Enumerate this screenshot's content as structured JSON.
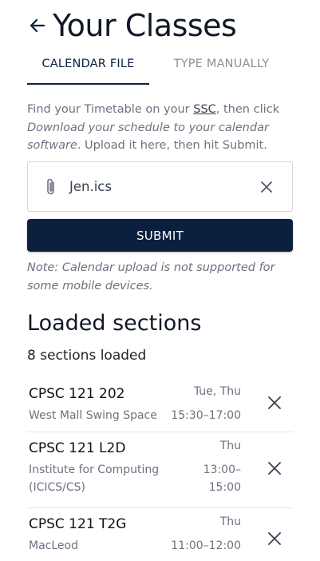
{
  "header": {
    "title": "Your Classes",
    "back_icon": "arrow-left-icon"
  },
  "tabs": [
    {
      "label": "CALENDAR FILE",
      "active": true
    },
    {
      "label": "TYPE MANUALLY",
      "active": false
    }
  ],
  "instructions": {
    "part1": "Find your Timetable on your ",
    "link": "SSC",
    "part2": ", then click ",
    "emphasis": "Download your schedule to your calendar software",
    "part3": ". Upload it here, then hit Submit."
  },
  "file_field": {
    "file_name": "Jen.ics",
    "attach_icon": "paperclip-icon",
    "clear_icon": "close-icon"
  },
  "submit_label": "SUBMIT",
  "note": "Note: Calendar upload is not supported for some mobile devices.",
  "loaded": {
    "heading": "Loaded sections",
    "count": "8 sections loaded",
    "sections": [
      {
        "code": "CPSC 121 202",
        "location": "West Mall Swing Space",
        "days": "Tue, Thu",
        "time": "15:30–17:00"
      },
      {
        "code": "CPSC 121 L2D",
        "location": "Institute for Computing (ICICS/CS)",
        "days": "Thu",
        "time": "13:00–15:00"
      },
      {
        "code": "CPSC 121 T2G",
        "location": "MacLeod",
        "days": "Thu",
        "time": "11:00–12:00"
      }
    ]
  },
  "colors": {
    "primary": "#0b1f3f",
    "muted_text": "#6b7280",
    "border": "#d5d7db"
  }
}
